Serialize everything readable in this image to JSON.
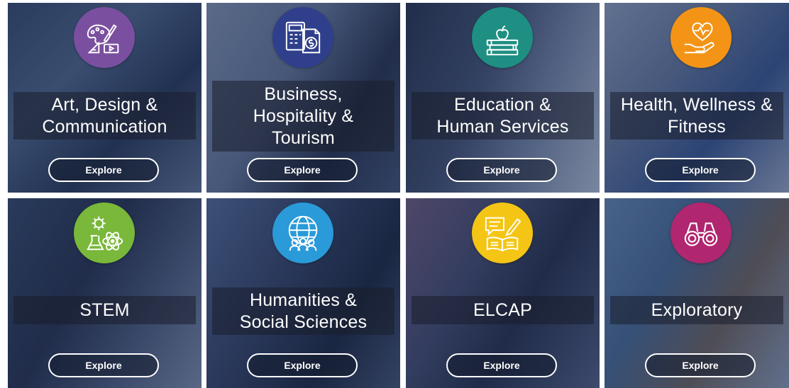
{
  "tiles": [
    {
      "title": "Art, Design &\nCommunication",
      "button": "Explore",
      "icon": "art-palette-icon",
      "color": "#7b4fa0"
    },
    {
      "title": "Business,\nHospitality &\nTourism",
      "button": "Explore",
      "icon": "business-calculator-icon",
      "color": "#2f3f8c"
    },
    {
      "title": "Education &\nHuman Services",
      "button": "Explore",
      "icon": "education-books-apple-icon",
      "color": "#1e8f82"
    },
    {
      "title": "Health, Wellness &\nFitness",
      "button": "Explore",
      "icon": "health-heart-hand-icon",
      "color": "#f39417"
    },
    {
      "title": "STEM",
      "button": "Explore",
      "icon": "stem-gear-flask-atom-icon",
      "color": "#79b83a"
    },
    {
      "title": "Humanities &\nSocial Sciences",
      "button": "Explore",
      "icon": "humanities-globe-people-icon",
      "color": "#2a9ad8"
    },
    {
      "title": "ELCAP",
      "button": "Explore",
      "icon": "elcap-speech-book-pen-icon",
      "color": "#f4c514"
    },
    {
      "title": "Exploratory",
      "button": "Explore",
      "icon": "exploratory-binoculars-icon",
      "color": "#b0266f"
    }
  ]
}
